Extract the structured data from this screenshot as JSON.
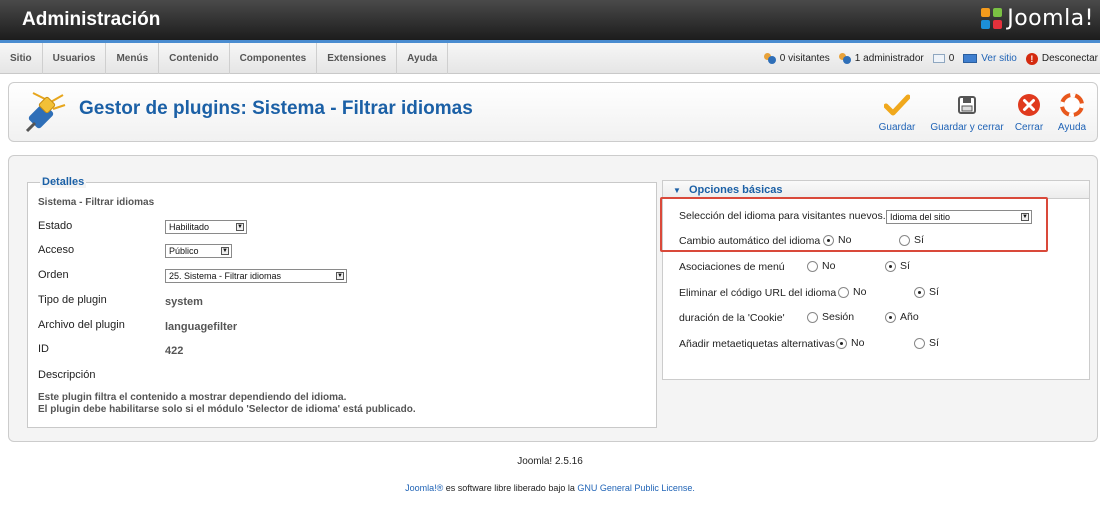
{
  "header": {
    "title": "Administración",
    "logo_text": "Joomla!"
  },
  "menu": {
    "items": [
      "Sitio",
      "Usuarios",
      "Menús",
      "Contenido",
      "Componentes",
      "Extensiones",
      "Ayuda"
    ]
  },
  "status": {
    "visitors": "0 visitantes",
    "admins": "1 administrador",
    "messages": "0",
    "view_site": "Ver sitio",
    "logout": "Desconectar"
  },
  "toolbar": {
    "page_title": "Gestor de plugins: Sistema - Filtrar idiomas",
    "save": "Guardar",
    "save_close": "Guardar y cerrar",
    "close": "Cerrar",
    "help": "Ayuda"
  },
  "details": {
    "legend": "Detalles",
    "plugin_name": "Sistema - Filtrar idiomas",
    "estado_label": "Estado",
    "estado_value": "Habilitado",
    "acceso_label": "Acceso",
    "acceso_value": "Público",
    "orden_label": "Orden",
    "orden_value": "25. Sistema - Filtrar idiomas",
    "tipo_label": "Tipo de plugin",
    "tipo_value": "system",
    "archivo_label": "Archivo del plugin",
    "archivo_value": "languagefilter",
    "id_label": "ID",
    "id_value": "422",
    "descripcion_label": "Descripción",
    "desc_line1": "Este plugin filtra el contenido a mostrar dependiendo del idioma.",
    "desc_line2": "El plugin debe habilitarse solo si el módulo 'Selector de idioma' está publicado."
  },
  "options": {
    "heading": "Opciones básicas",
    "seleccion_label": "Selección del idioma para visitantes nuevos.",
    "seleccion_value": "Idioma del sitio",
    "cambio_label": "Cambio automático del idioma",
    "asociaciones_label": "Asociaciones de menú",
    "eliminar_label": "Eliminar el código URL del idioma",
    "cookie_label": "duración de la 'Cookie'",
    "meta_label": "Añadir metaetiquetas alternativas",
    "no": "No",
    "si": "Sí",
    "sesion": "Sesión",
    "ano": "Año",
    "selected": {
      "cambio": "No",
      "asociaciones": "Sí",
      "eliminar": "Sí",
      "cookie": "Año",
      "meta": "No"
    }
  },
  "footer": {
    "version": "Joomla! 2.5.16",
    "license_prefix": "Joomla!® es software libre liberado bajo la",
    "license_link": "GNU General Public License."
  },
  "colors": {
    "accent": "#1b60a6",
    "highlight": "#d9493a",
    "menu_border": "#4a8cd0"
  }
}
